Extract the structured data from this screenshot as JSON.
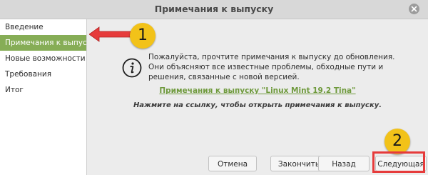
{
  "window": {
    "title": "Примечания к выпуску"
  },
  "sidebar": {
    "items": [
      {
        "label": "Введение"
      },
      {
        "label": "Примечания к выпуску"
      },
      {
        "label": "Новые возможности"
      },
      {
        "label": "Требования"
      },
      {
        "label": "Итог"
      }
    ],
    "active_index": 1
  },
  "content": {
    "info_text": "Пожалуйста, прочтите примечания к выпуску до обновления. Они объясняют все известные проблемы, обходные пути и решения, связанные с новой версией.",
    "notes_link": "Примечания к выпуску \"Linux Mint 19.2 Tina\"",
    "hint": "Нажмите на ссылку, чтобы открыть примечания к выпуску."
  },
  "buttons": {
    "cancel": "Отмена",
    "finish": "Закончить",
    "back": "Назад",
    "next": "Следующая"
  },
  "annotations": {
    "badge_1": "1",
    "badge_2": "2",
    "arrow_color": "#e63b3b",
    "badge_color": "#f2c219"
  },
  "colors": {
    "accent": "#86ad56",
    "link": "#6f9a3d"
  }
}
